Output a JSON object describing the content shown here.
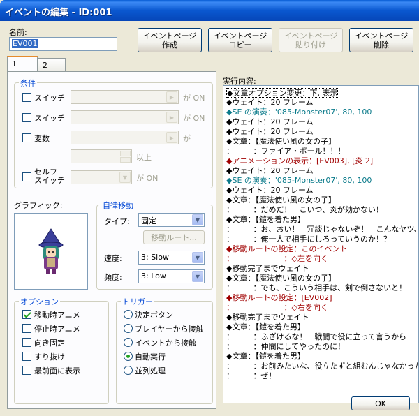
{
  "window": {
    "title": "イベントの編集 - ID:001"
  },
  "name_field": {
    "label": "名前:",
    "value": "EV001"
  },
  "page_buttons": {
    "create": "イベントページ\n作成",
    "copy": "イベントページ\nコピー",
    "paste": "イベントページ\n貼り付け",
    "delete": "イベントページ\n削除"
  },
  "tabs": [
    "1",
    "2"
  ],
  "conditions": {
    "title": "条件",
    "switch1": "スイッチ",
    "switch2": "スイッチ",
    "variable": "変数",
    "self_switch": "セルフ\nスイッチ",
    "ga_on": "が ON",
    "ga": "が",
    "ijou": "以上"
  },
  "graphic": {
    "label": "グラフィック:"
  },
  "autonomous": {
    "title": "自律移動",
    "type_label": "タイプ:",
    "type_value": "固定",
    "route_button": "移動ルート...",
    "speed_label": "速度:",
    "speed_value": "3: Slow",
    "freq_label": "頻度:",
    "freq_value": "3: Low"
  },
  "options": {
    "title": "オプション",
    "items": [
      {
        "label": "移動時アニメ",
        "checked": true
      },
      {
        "label": "停止時アニメ",
        "checked": false
      },
      {
        "label": "向き固定",
        "checked": false
      },
      {
        "label": "すり抜け",
        "checked": false
      },
      {
        "label": "最前面に表示",
        "checked": false
      }
    ]
  },
  "trigger": {
    "title": "トリガー",
    "items": [
      {
        "label": "決定ボタン",
        "selected": false
      },
      {
        "label": "プレイヤーから接触",
        "selected": false
      },
      {
        "label": "イベントから接触",
        "selected": false
      },
      {
        "label": "自動実行",
        "selected": true
      },
      {
        "label": "並列処理",
        "selected": false
      }
    ]
  },
  "contents": {
    "label": "実行内容:",
    "lines": [
      {
        "text": "◆文章オプション変更：下, 表示",
        "color": "#000000"
      },
      {
        "text": "◆ウェイト：20 フレーム",
        "color": "#000000"
      },
      {
        "text": "◆SE の演奏：'085-Monster07', 80, 100",
        "color": "#0a7a8a"
      },
      {
        "text": "◆ウェイト：20 フレーム",
        "color": "#000000"
      },
      {
        "text": "◆ウェイト：20 フレーム",
        "color": "#000000"
      },
      {
        "text": "◆文章：【魔法使い風の女の子】",
        "color": "#000000"
      },
      {
        "text": "：　　　：ファイア・ボール！！！",
        "color": "#000000"
      },
      {
        "text": "◆アニメーションの表示：[EV003], [炎 2]",
        "color": "#a00000"
      },
      {
        "text": "◆ウェイト：20 フレーム",
        "color": "#000000"
      },
      {
        "text": "◆SE の演奏：'085-Monster07', 80, 100",
        "color": "#0a7a8a"
      },
      {
        "text": "◆ウェイト：20 フレーム",
        "color": "#000000"
      },
      {
        "text": "◆文章：【魔法使い風の女の子】",
        "color": "#000000"
      },
      {
        "text": "：　　　：だめだ！　こいつ、炎が効かない！",
        "color": "#000000"
      },
      {
        "text": "◆文章：【鎧を着た男】",
        "color": "#000000"
      },
      {
        "text": "：　　　：お、おい！　冗談じゃないぞ！　こんなヤツ、",
        "color": "#000000"
      },
      {
        "text": "：　　　：俺一人で相手にしろっていうのか！？",
        "color": "#000000"
      },
      {
        "text": "◆移動ルートの設定：このイベント",
        "color": "#a00000"
      },
      {
        "text": "：　　　　　　　：◇左を向く",
        "color": "#a00000"
      },
      {
        "text": "◆移動完了までウェイト",
        "color": "#000000"
      },
      {
        "text": "◆文章：【魔法使い風の女の子】",
        "color": "#000000"
      },
      {
        "text": "：　　　：でも、こういう相手は、剣で倒さないと！",
        "color": "#000000"
      },
      {
        "text": "◆移動ルートの設定：[EV002]",
        "color": "#a00000"
      },
      {
        "text": "：　　　　　　　：◇右を向く",
        "color": "#a00000"
      },
      {
        "text": "◆移動完了までウェイト",
        "color": "#000000"
      },
      {
        "text": "◆文章：【鎧を着た男】",
        "color": "#000000"
      },
      {
        "text": "：　　　：ふざけるな！　戦闘で役に立って言うから",
        "color": "#000000"
      },
      {
        "text": "：　　　：仲間にしてやったのに！",
        "color": "#000000"
      },
      {
        "text": "◆文章：【鎧を着た男】",
        "color": "#000000"
      },
      {
        "text": "：　　　：お前みたいな、役立たずと組むんじゃなかった",
        "color": "#000000"
      },
      {
        "text": "：　　　：ぜ！",
        "color": "#000000"
      }
    ]
  },
  "footer": {
    "ok": "OK"
  }
}
